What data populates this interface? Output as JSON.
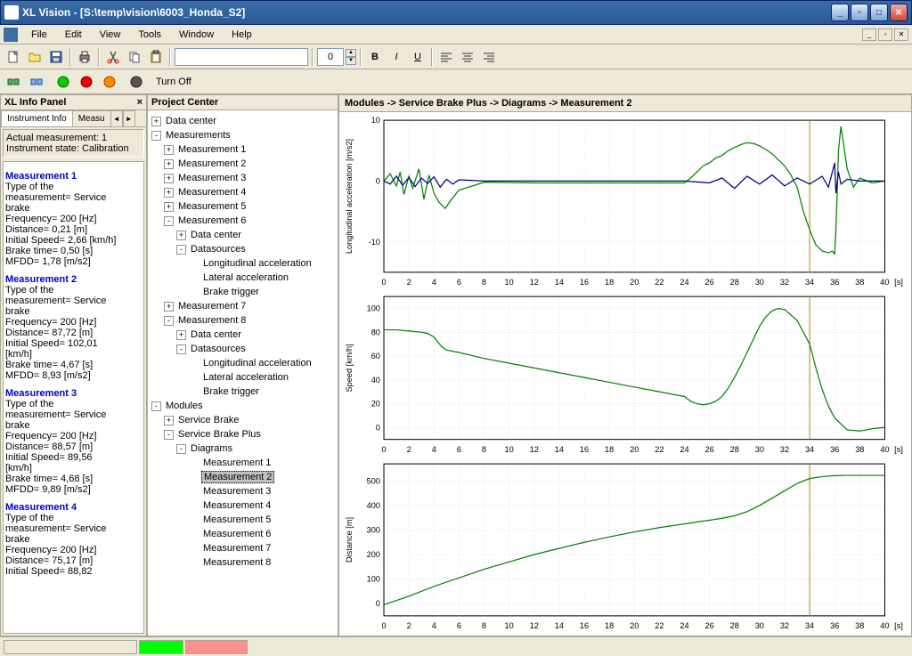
{
  "window": {
    "title": "XL Vision - [S:\\temp\\vision\\6003_Honda_S2]"
  },
  "menu": [
    "File",
    "Edit",
    "View",
    "Tools",
    "Window",
    "Help"
  ],
  "toolbar": {
    "spin_value": "0",
    "turnoff_label": "Turn Off"
  },
  "info_panel": {
    "title": "XL Info Panel",
    "tabs": [
      "Instrument Info",
      "Measu"
    ],
    "status": {
      "line1": "Actual measurement: 1",
      "line2": "Instrument state: Calibration"
    },
    "measurements": [
      {
        "head": "Measurement 1",
        "lines": [
          "Type of the",
          "measurement= Service",
          "brake",
          "Frequency= 200 [Hz]",
          "Distance= 0,21 [m]",
          "Initial Speed= 2,66 [km/h]",
          "Brake time= 0,50 [s]",
          "MFDD= 1,78 [m/s2]"
        ]
      },
      {
        "head": "Measurement 2",
        "lines": [
          "Type of the",
          "measurement= Service",
          "brake",
          "Frequency= 200 [Hz]",
          "Distance= 87,72 [m]",
          "Initial Speed= 102,01",
          "[km/h]",
          "Brake time= 4,67 [s]",
          "MFDD= 8,93 [m/s2]"
        ]
      },
      {
        "head": "Measurement 3",
        "lines": [
          "Type of the",
          "measurement= Service",
          "brake",
          "Frequency= 200 [Hz]",
          "Distance= 88,57 [m]",
          "Initial Speed= 89,56",
          "[km/h]",
          "Brake time= 4,68 [s]",
          "MFDD= 9,89 [m/s2]"
        ]
      },
      {
        "head": "Measurement 4",
        "lines": [
          "Type of the",
          "measurement= Service",
          "brake",
          "Frequency= 200 [Hz]",
          "Distance= 75,17 [m]",
          "Initial Speed= 88,82"
        ]
      }
    ]
  },
  "project_center": {
    "title": "Project Center",
    "tree": [
      {
        "ind": 0,
        "pm": "+",
        "label": "Data center"
      },
      {
        "ind": 0,
        "pm": "-",
        "label": "Measurements"
      },
      {
        "ind": 1,
        "pm": "+",
        "label": "Measurement 1"
      },
      {
        "ind": 1,
        "pm": "+",
        "label": "Measurement 2"
      },
      {
        "ind": 1,
        "pm": "+",
        "label": "Measurement 3"
      },
      {
        "ind": 1,
        "pm": "+",
        "label": "Measurement 4"
      },
      {
        "ind": 1,
        "pm": "+",
        "label": "Measurement 5"
      },
      {
        "ind": 1,
        "pm": "-",
        "label": "Measurement 6"
      },
      {
        "ind": 2,
        "pm": "+",
        "label": "Data center"
      },
      {
        "ind": 2,
        "pm": "-",
        "label": "Datasources"
      },
      {
        "ind": 3,
        "pm": "",
        "label": "Longitudinal acceleration"
      },
      {
        "ind": 3,
        "pm": "",
        "label": "Lateral acceleration"
      },
      {
        "ind": 3,
        "pm": "",
        "label": "Brake trigger"
      },
      {
        "ind": 1,
        "pm": "+",
        "label": "Measurement 7"
      },
      {
        "ind": 1,
        "pm": "-",
        "label": "Measurement 8"
      },
      {
        "ind": 2,
        "pm": "+",
        "label": "Data center"
      },
      {
        "ind": 2,
        "pm": "-",
        "label": "Datasources"
      },
      {
        "ind": 3,
        "pm": "",
        "label": "Longitudinal acceleration"
      },
      {
        "ind": 3,
        "pm": "",
        "label": "Lateral acceleration"
      },
      {
        "ind": 3,
        "pm": "",
        "label": "Brake trigger"
      },
      {
        "ind": 0,
        "pm": "-",
        "label": "Modules"
      },
      {
        "ind": 1,
        "pm": "+",
        "label": "Service Brake"
      },
      {
        "ind": 1,
        "pm": "-",
        "label": "Service Brake Plus"
      },
      {
        "ind": 2,
        "pm": "-",
        "label": "Diagrams"
      },
      {
        "ind": 3,
        "pm": "",
        "label": "Measurement 1"
      },
      {
        "ind": 3,
        "pm": "",
        "label": "Measurement 2",
        "sel": true
      },
      {
        "ind": 3,
        "pm": "",
        "label": "Measurement 3"
      },
      {
        "ind": 3,
        "pm": "",
        "label": "Measurement 4"
      },
      {
        "ind": 3,
        "pm": "",
        "label": "Measurement 5"
      },
      {
        "ind": 3,
        "pm": "",
        "label": "Measurement 6"
      },
      {
        "ind": 3,
        "pm": "",
        "label": "Measurement 7"
      },
      {
        "ind": 3,
        "pm": "",
        "label": "Measurement 8"
      }
    ]
  },
  "breadcrumb": "Modules -> Service Brake Plus -> Diagrams -> Measurement 2",
  "chart_data": [
    {
      "type": "line",
      "ylabel": "Longitudinal acceleration [m/s2]",
      "xlabel": "[s]",
      "xlim": [
        0,
        40
      ],
      "ylim": [
        -15,
        10
      ],
      "yticks": [
        -10,
        0,
        10
      ],
      "cursor_x": 34,
      "series": [
        {
          "name": "green",
          "color": "#008000",
          "x": [
            0,
            0.5,
            1,
            1.3,
            1.6,
            2,
            2.3,
            2.8,
            3.2,
            3.6,
            4,
            4.4,
            4.9,
            5.4,
            6,
            8,
            12,
            16,
            20,
            24,
            24.5,
            25,
            25.5,
            26,
            26.5,
            27,
            27.5,
            28,
            28.5,
            29,
            29.5,
            30,
            30.5,
            31,
            31.5,
            32,
            32.5,
            33,
            33.5,
            34,
            34.5,
            35,
            35.5,
            35.8,
            36,
            36.1,
            36.2,
            36.3,
            36.5,
            37,
            37.5,
            38,
            39,
            40
          ],
          "y": [
            0,
            1.2,
            -0.8,
            1.5,
            -2.2,
            0.8,
            -1.2,
            2,
            -3,
            1,
            -2,
            -3.5,
            -4.5,
            -3,
            -1.5,
            -0.2,
            -0.3,
            -0.3,
            -0.3,
            -0.3,
            0.5,
            1.5,
            2.5,
            3,
            3.8,
            4.2,
            5,
            5.5,
            6,
            6.3,
            6.2,
            5.8,
            5.2,
            4.5,
            3.5,
            2.5,
            1,
            -1,
            -5,
            -8,
            -10.5,
            -11.5,
            -11.8,
            -11.5,
            -12,
            -8,
            -2,
            5,
            9,
            2,
            -1,
            0.5,
            -0.3,
            0
          ]
        },
        {
          "name": "blue",
          "color": "#000080",
          "x": [
            0,
            0.5,
            1,
            1.5,
            2,
            2.5,
            3,
            3.5,
            4,
            4.5,
            5,
            5.5,
            6,
            8,
            12,
            16,
            20,
            24,
            26,
            27,
            28,
            29,
            30,
            31,
            32,
            33,
            34,
            35,
            35.5,
            36,
            36.1,
            36.3,
            36.5,
            37,
            38,
            39,
            40
          ],
          "y": [
            0,
            -0.5,
            0.8,
            -0.7,
            0.6,
            -0.9,
            0.5,
            -0.4,
            0.7,
            -1,
            0.3,
            -0.5,
            0.2,
            0,
            0,
            0,
            0,
            0,
            -0.3,
            0.5,
            -1.2,
            0.8,
            -0.5,
            1,
            -0.8,
            0.5,
            -0.5,
            0.8,
            -1,
            3,
            -2,
            1.5,
            -0.5,
            0.3,
            0,
            0,
            0
          ]
        }
      ]
    },
    {
      "type": "line",
      "ylabel": "Speed [km/h]",
      "xlabel": "[s]",
      "xlim": [
        0,
        40
      ],
      "ylim": [
        -10,
        110
      ],
      "yticks": [
        0,
        20,
        40,
        60,
        80,
        100
      ],
      "cursor_x": 34,
      "series": [
        {
          "name": "green",
          "color": "#008000",
          "x": [
            0,
            1,
            2,
            3,
            3.5,
            4,
            4.3,
            4.6,
            5,
            6,
            8,
            10,
            12,
            14,
            16,
            18,
            20,
            22,
            24,
            24.5,
            25,
            25.5,
            26,
            26.5,
            27,
            27.5,
            28,
            28.5,
            29,
            29.5,
            30,
            30.5,
            31,
            31.5,
            32,
            33,
            34,
            34.5,
            35,
            35.5,
            36,
            37,
            38,
            39,
            40
          ],
          "y": [
            82,
            82,
            81,
            80,
            79,
            76,
            72,
            68,
            65,
            63,
            58,
            54,
            50,
            46,
            42,
            38,
            34,
            30,
            26,
            22,
            20,
            19,
            20,
            22,
            26,
            33,
            42,
            52,
            63,
            74,
            85,
            93,
            98,
            100,
            99,
            90,
            70,
            50,
            32,
            18,
            8,
            -2,
            -3,
            -1,
            0
          ]
        }
      ]
    },
    {
      "type": "line",
      "ylabel": "Distance [m]",
      "xlabel": "[s]",
      "xlim": [
        0,
        40
      ],
      "ylim": [
        -50,
        570
      ],
      "yticks": [
        0,
        100,
        200,
        300,
        400,
        500
      ],
      "cursor_x": 34,
      "series": [
        {
          "name": "green",
          "color": "#008000",
          "x": [
            0,
            2,
            4,
            6,
            8,
            10,
            12,
            14,
            16,
            18,
            20,
            22,
            24,
            25,
            26,
            27,
            28,
            29,
            30,
            31,
            32,
            33,
            34,
            35,
            36,
            37,
            38,
            39,
            40
          ],
          "y": [
            -5,
            30,
            70,
            105,
            140,
            170,
            200,
            225,
            250,
            272,
            292,
            310,
            325,
            333,
            340,
            348,
            358,
            375,
            400,
            430,
            460,
            490,
            510,
            518,
            522,
            523,
            523,
            523,
            523
          ]
        }
      ]
    }
  ],
  "colors": {
    "accent": "#316ac5",
    "status_green": "#00ff00",
    "status_red": "#ff8080"
  }
}
